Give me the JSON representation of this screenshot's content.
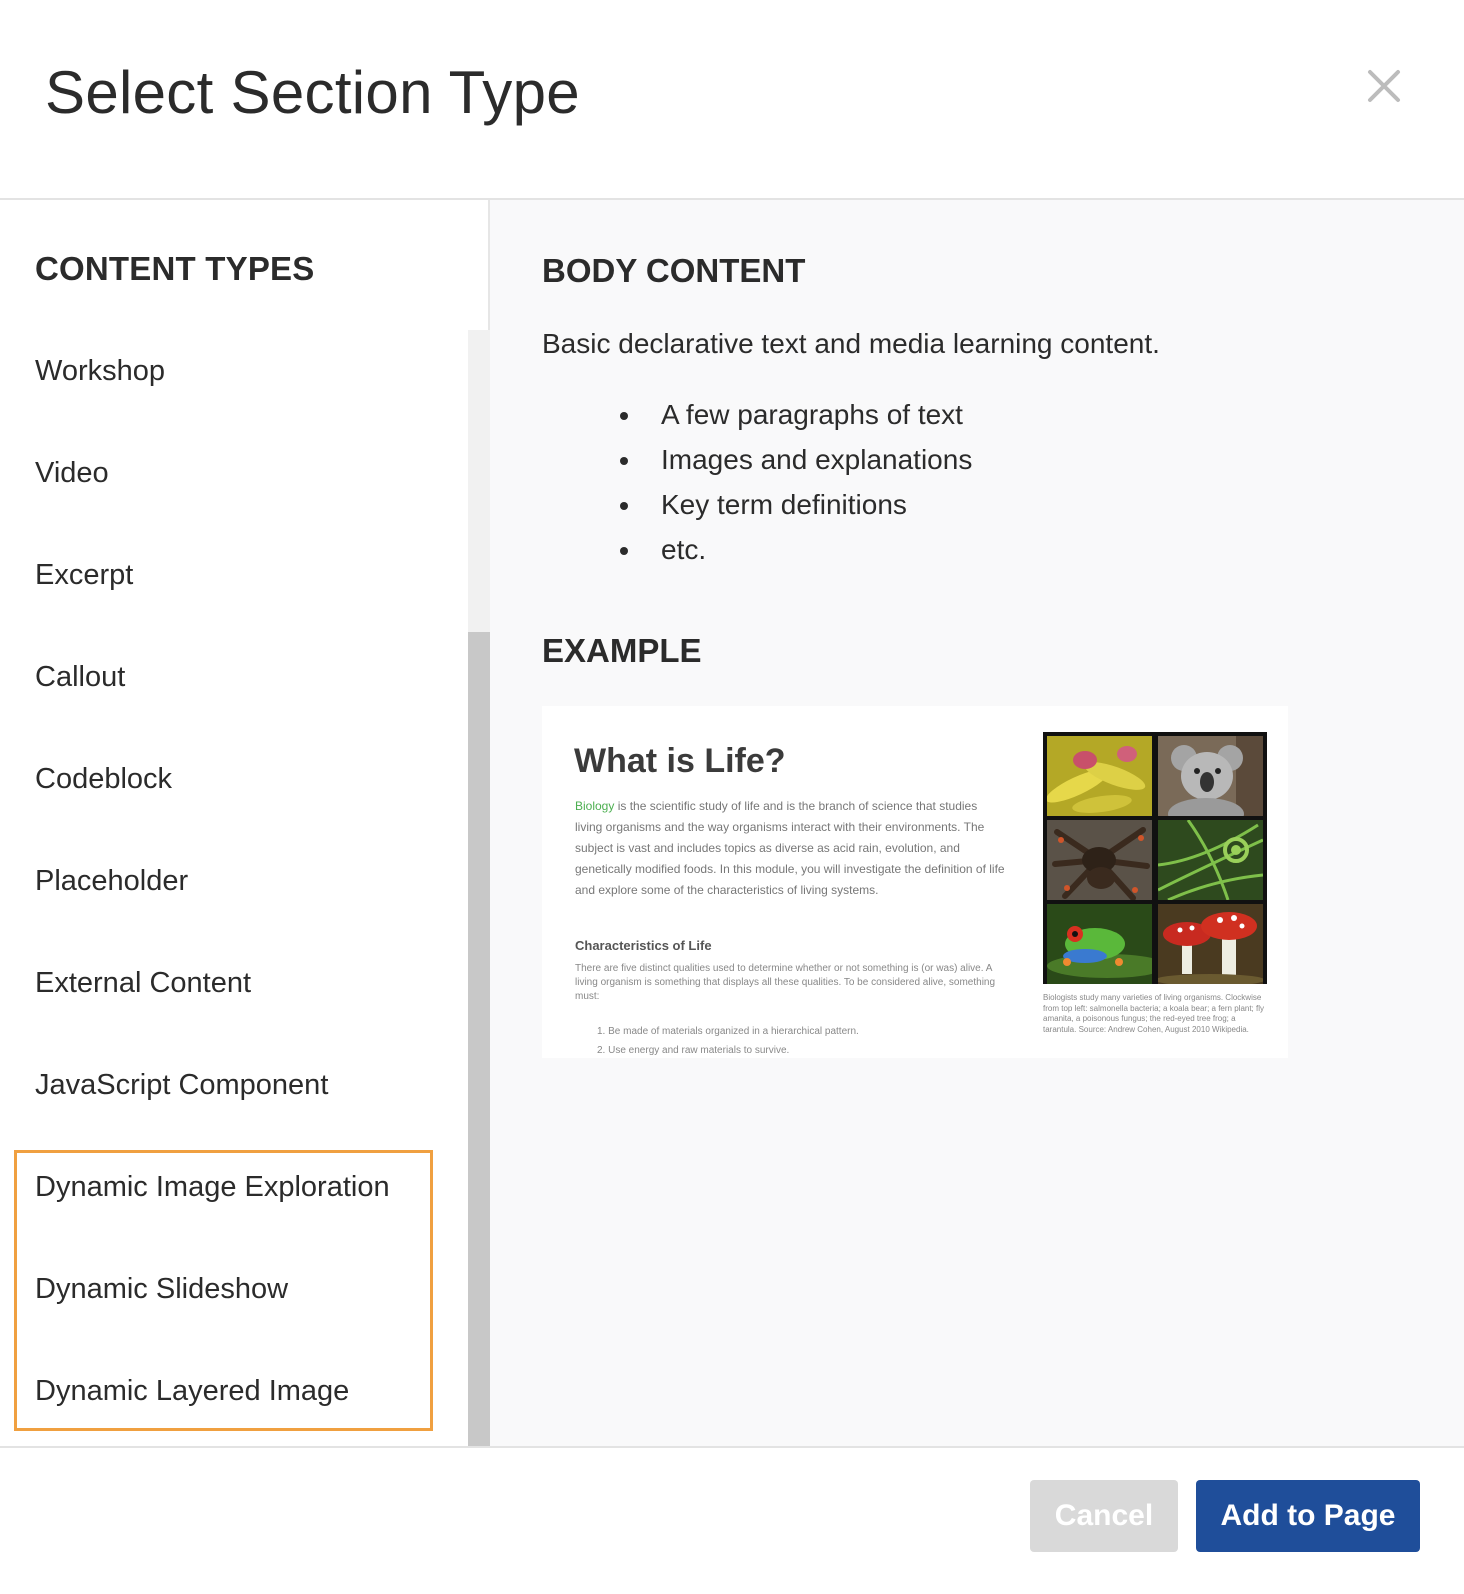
{
  "dialog": {
    "title": "Select Section Type"
  },
  "sidebar": {
    "heading": "CONTENT TYPES",
    "items": [
      {
        "label": "Workshop"
      },
      {
        "label": "Video"
      },
      {
        "label": "Excerpt"
      },
      {
        "label": "Callout"
      },
      {
        "label": "Codeblock"
      },
      {
        "label": "Placeholder"
      },
      {
        "label": "External Content"
      },
      {
        "label": "JavaScript Component"
      },
      {
        "label": "Dynamic Image Exploration"
      },
      {
        "label": "Dynamic Slideshow"
      },
      {
        "label": "Dynamic Layered Image"
      }
    ]
  },
  "main": {
    "heading": "BODY CONTENT",
    "description": "Basic declarative text and media learning content.",
    "bullets": [
      "A few paragraphs of text",
      "Images and explanations",
      "Key term definitions",
      "etc."
    ],
    "example_heading": "EXAMPLE",
    "example": {
      "title": "What is Life?",
      "link_word": "Biology",
      "paragraph": " is the scientific study of life and is the branch of science that studies living organisms and the way organisms interact with their environments. The subject is vast and includes topics as diverse as acid rain, evolution, and genetically modified foods. In this module, you will investigate the definition of life and explore some of the characteristics of living systems.",
      "subheading": "Characteristics of Life",
      "paragraph2": "There are five distinct qualities used to determine whether or not something is (or was) alive. A living organism is something that displays all these qualities. To be considered alive, something must:",
      "list": [
        "1. Be made of materials organized in a hierarchical pattern.",
        "2. Use energy and raw materials to survive."
      ],
      "caption": "Biologists study many varieties of living organisms. Clockwise from top left: salmonella bacteria; a koala bear; a fern plant; fly amanita, a poisonous fungus; the red-eyed tree frog; a tarantula. Source: Andrew Cohen, August 2010 Wikipedia."
    }
  },
  "footer": {
    "cancel_label": "Cancel",
    "add_label": "Add to Page"
  },
  "colors": {
    "primary": "#1f4e9a",
    "highlight": "#f0a040",
    "disabled": "#d9d9d9"
  }
}
